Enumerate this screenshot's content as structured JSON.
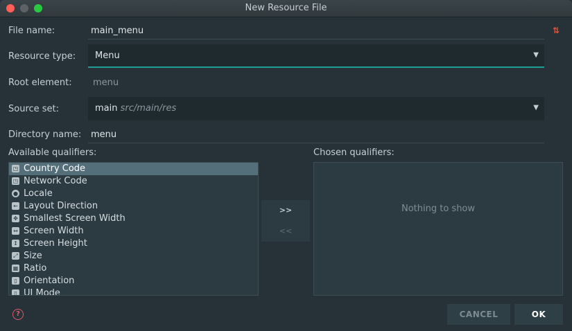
{
  "window": {
    "title": "New Resource File"
  },
  "form": {
    "file_name_label": "File name:",
    "file_name_value": "main_menu",
    "resource_type_label": "Resource type:",
    "resource_type_value": "Menu",
    "root_element_label": "Root element:",
    "root_element_value": "menu",
    "source_set_label": "Source set:",
    "source_set_value": "main",
    "source_set_path": "src/main/res",
    "directory_name_label": "Directory name:",
    "directory_name_value": "menu"
  },
  "qualifiers": {
    "available_label": "Available qualifiers:",
    "chosen_label": "Chosen qualifiers:",
    "items": [
      {
        "label": "Country Code",
        "icon": "country-code-icon",
        "selected": true
      },
      {
        "label": "Network Code",
        "icon": "network-code-icon"
      },
      {
        "label": "Locale",
        "icon": "globe-icon"
      },
      {
        "label": "Layout Direction",
        "icon": "layout-direction-icon"
      },
      {
        "label": "Smallest Screen Width",
        "icon": "smallest-width-icon"
      },
      {
        "label": "Screen Width",
        "icon": "screen-width-icon"
      },
      {
        "label": "Screen Height",
        "icon": "screen-height-icon"
      },
      {
        "label": "Size",
        "icon": "size-icon"
      },
      {
        "label": "Ratio",
        "icon": "ratio-icon"
      },
      {
        "label": "Orientation",
        "icon": "orientation-icon"
      },
      {
        "label": "UI Mode",
        "icon": "ui-mode-icon"
      }
    ],
    "add_label": ">>",
    "remove_label": "<<",
    "empty_text": "Nothing to show"
  },
  "buttons": {
    "cancel": "CANCEL",
    "ok": "OK"
  },
  "colors": {
    "background": "#263238",
    "accent": "#1e9e96",
    "selection": "#546e7a"
  }
}
